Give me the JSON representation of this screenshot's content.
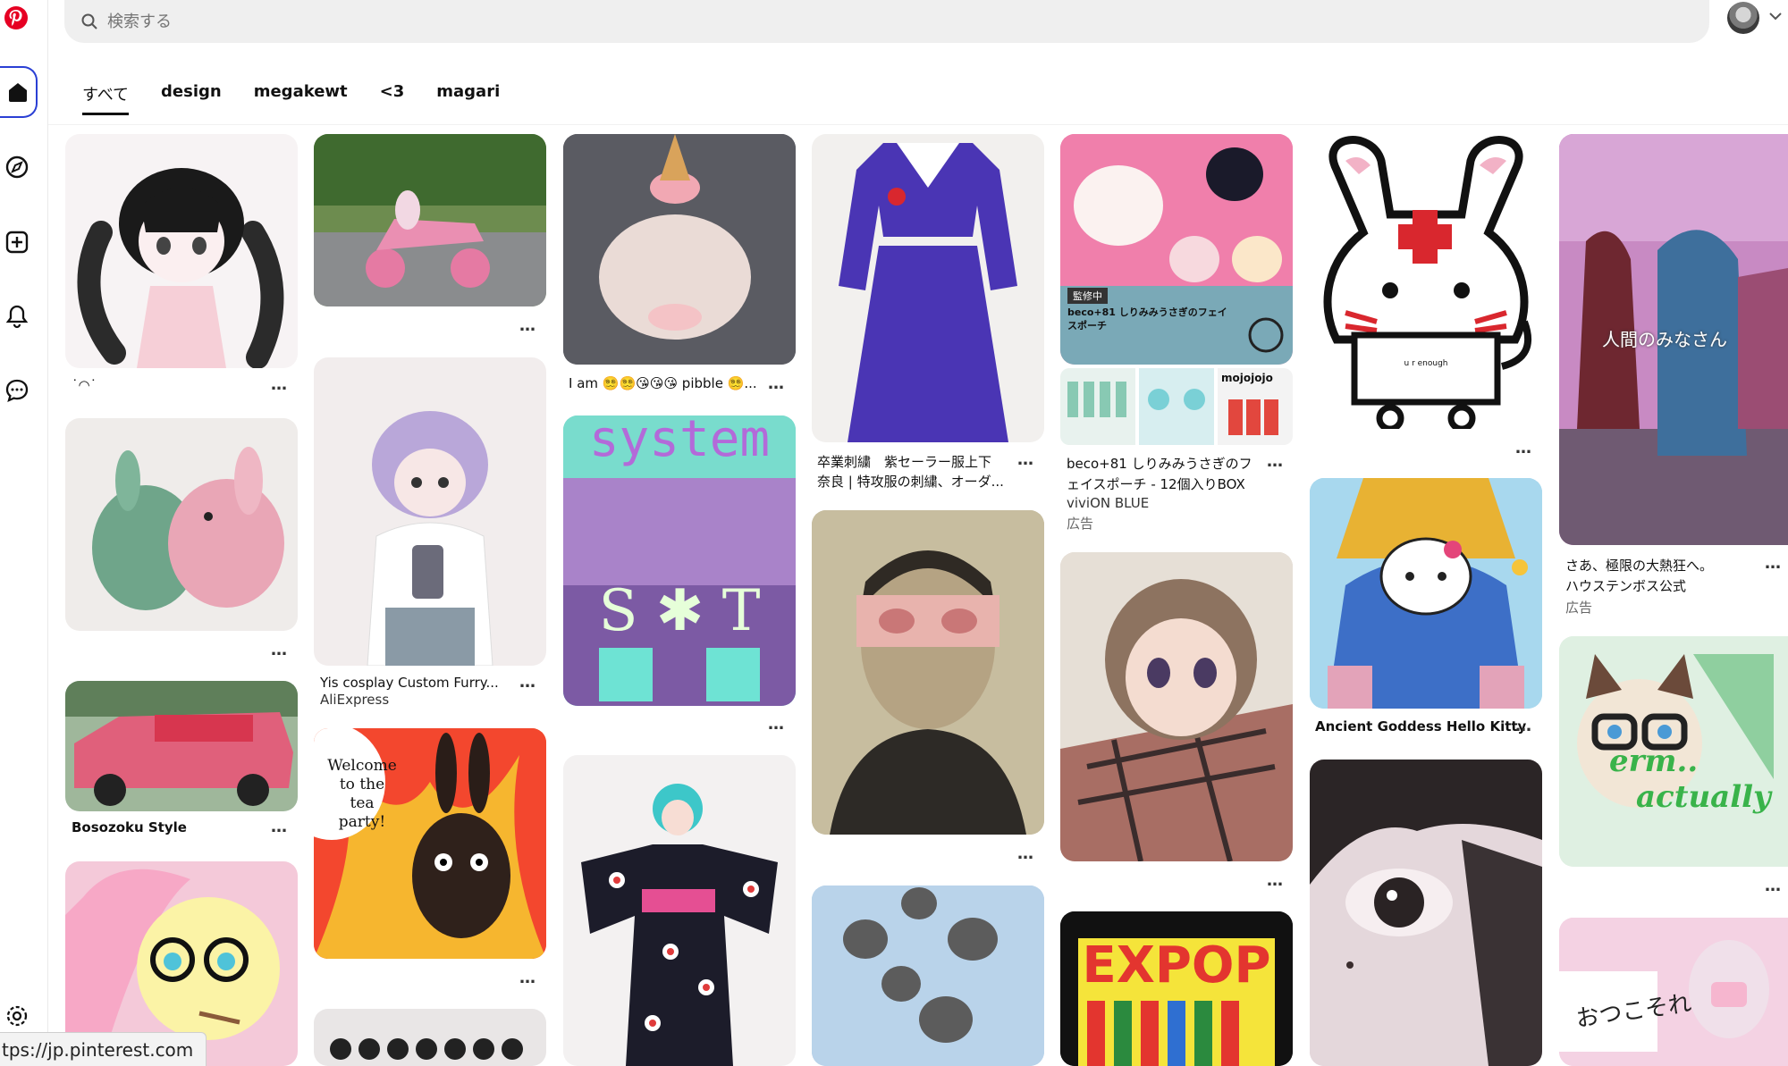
{
  "search": {
    "placeholder": "検索する"
  },
  "tabs": [
    {
      "label": "すべて"
    },
    {
      "label": "design"
    },
    {
      "label": "megakewt"
    },
    {
      "label": "<3"
    },
    {
      "label": "magari"
    }
  ],
  "pins": {
    "kaomoji": {
      "title": "˙◠˙"
    },
    "bosozoku": {
      "title": "Bosozoku Style"
    },
    "cosplay": {
      "title": "Yis cosplay Custom Furry...",
      "source": "AliExpress"
    },
    "welcome": {
      "text": "Welcome to the tea party!"
    },
    "pibble": {
      "title": "I am 😵‍💫😵‍💫😘😘😘 pibble 😵‍💫..."
    },
    "system": {
      "text": "system"
    },
    "sailor": {
      "title_line1": "卒業刺繍　紫セーラー服上下",
      "title_line2": "奈良 | 特攻服の刺繍、オーダ..."
    },
    "pouch": {
      "title_line1": "beco+81 しりみみうさぎのフ",
      "title_line2": "ェイスポーチ - 12個入りBOX",
      "source": "viviON BLUE",
      "ad": "広告",
      "badge": "監修中",
      "brand": "mojojojo",
      "banner": "beco+81 しりみみうさぎのフェイスポーチ"
    },
    "expop": {
      "text": "EXPOP"
    },
    "enough": {
      "text": "u r enough"
    },
    "hellokitty": {
      "title": "Ancient Goddess Hello Kitty"
    },
    "huis": {
      "title_line1": "さあ、極限の大熱狂へ。",
      "title_line2": "ハウステンボス公式",
      "ad": "広告",
      "overlay": "人間のみなさん"
    },
    "erm": {
      "text_line1": "erm..",
      "text_line2": "actually"
    },
    "sign": {
      "text": "おつこそれ"
    }
  },
  "more_label": "…",
  "status_url": "tps://jp.pinterest.com"
}
